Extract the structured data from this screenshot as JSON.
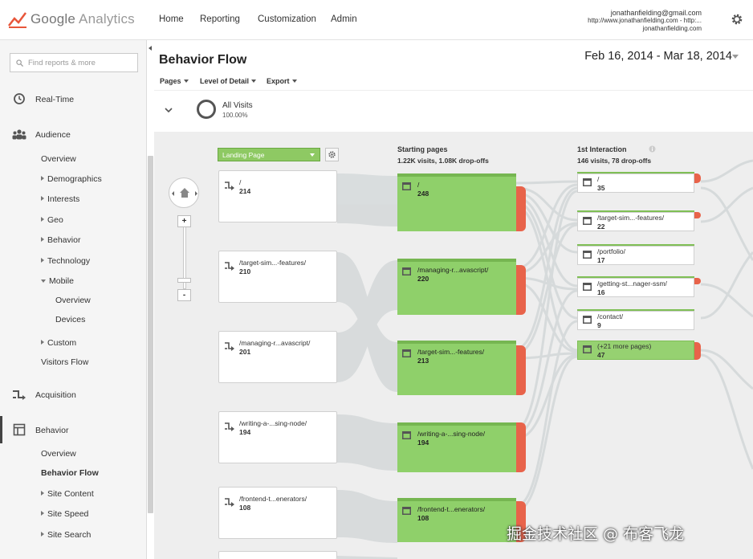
{
  "app": {
    "name_google": "Google",
    "name_product": "Analytics"
  },
  "nav": {
    "home": "Home",
    "reporting": "Reporting",
    "customization": "Customization",
    "admin": "Admin"
  },
  "account": {
    "email": "jonathanfielding@gmail.com",
    "property": "http://www.jonathanfielding.com - http:...",
    "profile": "jonathanfielding.com"
  },
  "sidebar": {
    "search_placeholder": "Find reports & more",
    "realtime": "Real-Time",
    "audience": "Audience",
    "audience_items": [
      "Overview",
      "Demographics",
      "Interests",
      "Geo",
      "Behavior",
      "Technology",
      "Mobile",
      "Overview",
      "Devices",
      "Custom",
      "Visitors Flow"
    ],
    "acquisition": "Acquisition",
    "behavior": "Behavior",
    "behavior_items": [
      "Overview",
      "Behavior Flow",
      "Site Content",
      "Site Speed",
      "Site Search"
    ]
  },
  "report": {
    "title": "Behavior Flow",
    "date_range": "Feb 16, 2014 - Mar 18, 2014",
    "controls": {
      "pages": "Pages",
      "level": "Level of Detail",
      "export": "Export"
    },
    "all_visits": {
      "label": "All Visits",
      "percent": "100.00%"
    }
  },
  "flow": {
    "dimension_select": "Landing Page",
    "starting": {
      "title": "Starting pages",
      "summary": "1.22K visits, 1.08K drop-offs"
    },
    "interaction": {
      "title": "1st Interaction",
      "summary": "146 visits, 78 drop-offs"
    },
    "landing_pages": [
      {
        "name": "/",
        "count": "214"
      },
      {
        "name": "/target-sim...-features/",
        "count": "210"
      },
      {
        "name": "/managing-r...avascript/",
        "count": "201"
      },
      {
        "name": "/writing-a-...sing-node/",
        "count": "194"
      },
      {
        "name": "/frontend-t...enerators/",
        "count": "108"
      }
    ],
    "starting_pages": [
      {
        "name": "/",
        "count": "248"
      },
      {
        "name": "/managing-r...avascript/",
        "count": "220"
      },
      {
        "name": "/target-sim...-features/",
        "count": "213"
      },
      {
        "name": "/writing-a-...sing-node/",
        "count": "194"
      },
      {
        "name": "/frontend-t...enerators/",
        "count": "108"
      }
    ],
    "interactions": [
      {
        "name": "/",
        "count": "35"
      },
      {
        "name": "/target-sim...-features/",
        "count": "22"
      },
      {
        "name": "/portfolio/",
        "count": "17"
      },
      {
        "name": "/getting-st...nager-ssm/",
        "count": "16"
      },
      {
        "name": "/contact/",
        "count": "9"
      },
      {
        "name": "(+21 more pages)",
        "count": "47"
      }
    ]
  },
  "zoom": {
    "in": "+",
    "out": "-"
  },
  "watermark": "掘金技术社区 @ 布客飞龙",
  "colors": {
    "green": "#8fd06a",
    "dropoff": "#e8634a",
    "flow": "#d3d8da"
  }
}
